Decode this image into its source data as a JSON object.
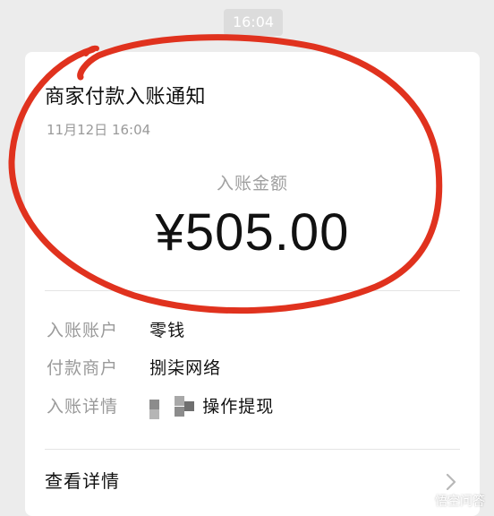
{
  "timestamp_pill": "16:04",
  "notification": {
    "title": "商家付款入账通知",
    "date": "11月12日 16:04",
    "amount_label": "入账金额",
    "amount": "¥505.00"
  },
  "details": [
    {
      "key": "入账账户",
      "value": "零钱"
    },
    {
      "key": "付款商户",
      "value": "捌柒网络"
    },
    {
      "key": "入账详情",
      "value": "操作提现",
      "obscured_prefix": "卖"
    }
  ],
  "footer": {
    "label": "查看详情"
  },
  "watermark": {
    "text": "悟空问答",
    "icon": "eye-logo-icon"
  },
  "colors": {
    "annotation_red": "#e0321e",
    "amount_text": "#111111",
    "secondary_text": "#9a9a9a"
  }
}
